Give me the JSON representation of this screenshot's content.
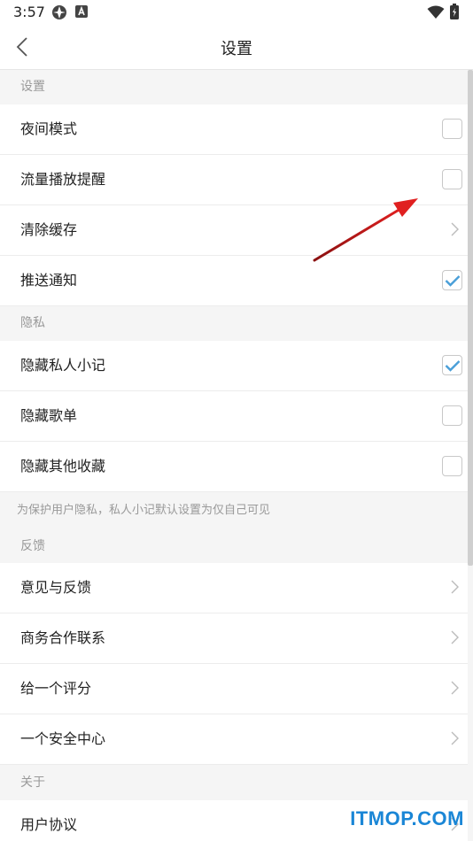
{
  "status_bar": {
    "time": "3:57"
  },
  "header": {
    "title": "设置"
  },
  "sections": {
    "settings": {
      "label": "设置",
      "items": [
        {
          "label": "夜间模式",
          "control": "checkbox",
          "checked": false
        },
        {
          "label": "流量播放提醒",
          "control": "checkbox",
          "checked": false
        },
        {
          "label": "清除缓存",
          "control": "chevron"
        },
        {
          "label": "推送通知",
          "control": "checkbox",
          "checked": true
        }
      ]
    },
    "privacy": {
      "label": "隐私",
      "items": [
        {
          "label": "隐藏私人小记",
          "control": "checkbox",
          "checked": true
        },
        {
          "label": "隐藏歌单",
          "control": "checkbox",
          "checked": false
        },
        {
          "label": "隐藏其他收藏",
          "control": "checkbox",
          "checked": false
        }
      ],
      "note": "为保护用户隐私，私人小记默认设置为仅自己可见"
    },
    "feedback": {
      "label": "反馈",
      "items": [
        {
          "label": "意见与反馈",
          "control": "chevron"
        },
        {
          "label": "商务合作联系",
          "control": "chevron"
        },
        {
          "label": "给一个评分",
          "control": "chevron"
        },
        {
          "label": "一个安全中心",
          "control": "chevron"
        }
      ]
    },
    "about": {
      "label": "关于",
      "items": [
        {
          "label": "用户协议",
          "control": "chevron"
        }
      ]
    }
  },
  "watermark": "ITMOP.COM",
  "colors": {
    "check_accent": "#4a9fd8",
    "annotation_arrow": "#e02020",
    "watermark": "#1a86d6"
  }
}
